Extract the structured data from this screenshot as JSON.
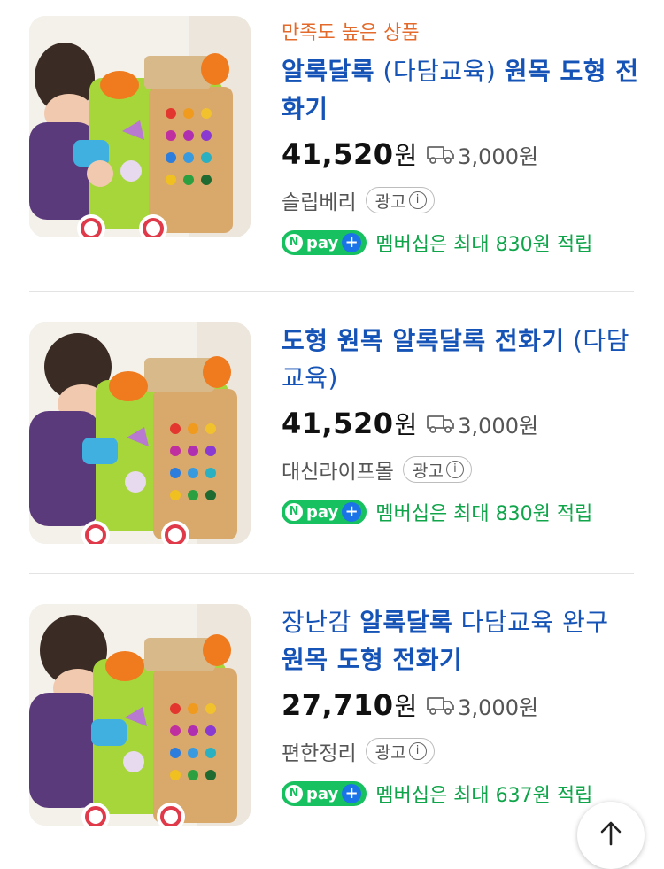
{
  "products": [
    {
      "badge": "만족도 높은 상품",
      "title_parts": [
        {
          "text": "알록달록",
          "highlight": true
        },
        {
          "text": " (다담교육) ",
          "highlight": false
        },
        {
          "text": "원목 도형 전화기",
          "highlight": true
        }
      ],
      "price": "41,520",
      "price_unit": "원",
      "shipping": "3,000원",
      "seller": "슬립베리",
      "ad_label": "광고",
      "npay_label": "pay",
      "npay_text": "멤버십은 최대 830원 적립"
    },
    {
      "badge": "",
      "title_parts": [
        {
          "text": "도형 원목 알록달록 전화기",
          "highlight": true
        },
        {
          "text": " (다담교육)",
          "highlight": false
        }
      ],
      "price": "41,520",
      "price_unit": "원",
      "shipping": "3,000원",
      "seller": "대신라이프몰",
      "ad_label": "광고",
      "npay_label": "pay",
      "npay_text": "멤버십은 최대 830원 적립"
    },
    {
      "badge": "",
      "title_parts": [
        {
          "text": "장난감 ",
          "highlight": false
        },
        {
          "text": "알록달록",
          "highlight": true
        },
        {
          "text": " 다담교육 완구 ",
          "highlight": false
        },
        {
          "text": "원목 도형 전화기",
          "highlight": true
        }
      ],
      "price": "27,710",
      "price_unit": "원",
      "shipping": "3,000원",
      "seller": "편한정리",
      "ad_label": "광고",
      "npay_label": "pay",
      "npay_text": "멤버십은 최대 637원 적립"
    }
  ],
  "icons": {
    "shipping": "truck-icon",
    "info": "info-icon",
    "scroll_top": "arrow-up-icon"
  },
  "colors": {
    "title": "#1553b6",
    "badge": "#e36a2a",
    "npay": "#18c160",
    "pay_text": "#10a54a"
  }
}
